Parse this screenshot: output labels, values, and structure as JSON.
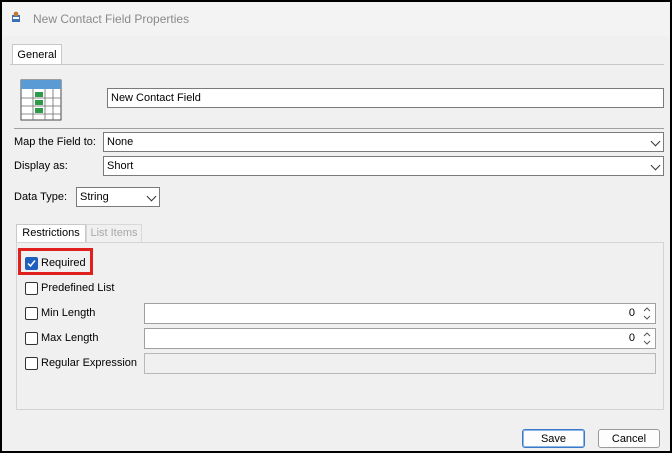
{
  "window": {
    "title": "New Contact Field Properties"
  },
  "tabs": {
    "general": "General"
  },
  "field": {
    "name": "New Contact Field"
  },
  "map": {
    "label": "Map the Field to:",
    "value": "None"
  },
  "display": {
    "label": "Display as:",
    "value": "Short"
  },
  "datatype": {
    "label": "Data Type:",
    "value": "String"
  },
  "subtabs": {
    "restrictions": "Restrictions",
    "list_items": "List Items"
  },
  "restrictions": {
    "required": {
      "label": "Required",
      "checked": true
    },
    "predefined": {
      "label": "Predefined List",
      "checked": false
    },
    "min_length": {
      "label": "Min Length",
      "checked": false,
      "value": "0"
    },
    "max_length": {
      "label": "Max Length",
      "checked": false,
      "value": "0"
    },
    "regex": {
      "label": "Regular Expression",
      "checked": false
    }
  },
  "buttons": {
    "save": "Save",
    "cancel": "Cancel"
  },
  "colors": {
    "highlight": "#e0201e",
    "check_accent": "#1f5fbf"
  },
  "icons": {
    "app": "contact-app-icon",
    "field": "table-grid-icon"
  }
}
